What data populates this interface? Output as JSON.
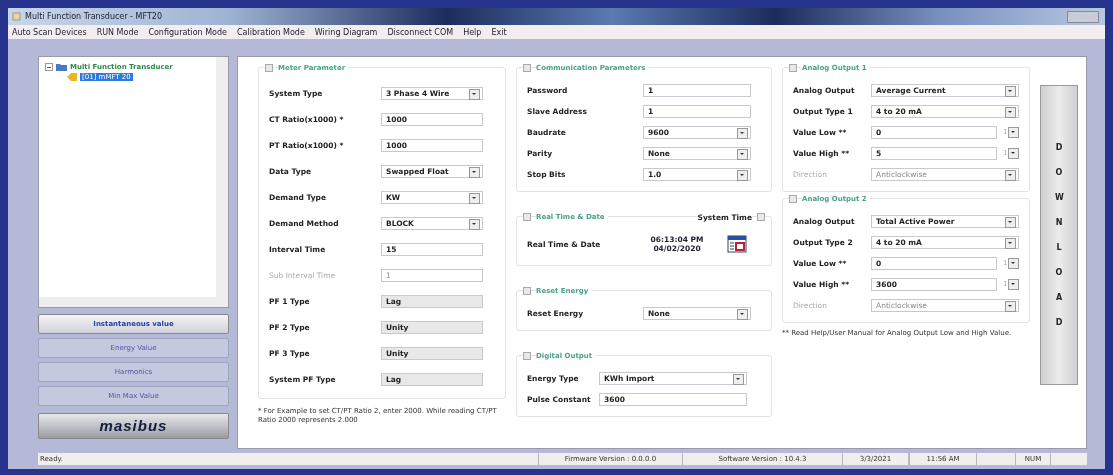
{
  "window": {
    "title": "Multi Function Transducer - MFT20"
  },
  "menu": [
    "Auto Scan Devices",
    "RUN Mode",
    "Configuration Mode",
    "Calibration Mode",
    "Wiring Diagram",
    "Disconnect COM",
    "Help",
    "Exit"
  ],
  "tree": {
    "label": "Multi Function Transducer",
    "expanded": true,
    "children": [
      {
        "label": "[01] mMFT 20",
        "selected": true
      }
    ]
  },
  "nav_buttons": [
    {
      "label": "Instantaneous value",
      "selected": true
    },
    {
      "label": "Energy Value",
      "selected": false
    },
    {
      "label": "Harmonics",
      "selected": false
    },
    {
      "label": "Min Max Value",
      "selected": false
    }
  ],
  "logo": "masibus",
  "columns": [
    {
      "groups": [
        {
          "title": "Meter Parameter",
          "checked": false,
          "rows": [
            {
              "label": "System Type",
              "kind": "dropdown",
              "value": "3 Phase 4 Wire",
              "disabled": false
            },
            {
              "label": "CT Ratio(x1000) *",
              "kind": "text",
              "value": "1000",
              "disabled": false
            },
            {
              "label": "PT Ratio(x1000) *",
              "kind": "text",
              "value": "1000",
              "disabled": false
            },
            {
              "label": "Data Type",
              "kind": "dropdown",
              "value": "Swapped Float",
              "disabled": false
            },
            {
              "label": "Demand Type",
              "kind": "dropdown",
              "value": "KW",
              "disabled": false
            },
            {
              "label": "Demand Method",
              "kind": "dropdown",
              "value": "BLOCK",
              "disabled": false
            },
            {
              "label": "Interval Time",
              "kind": "text",
              "value": "15",
              "disabled": false
            },
            {
              "label": "Sub Interval Time",
              "kind": "text",
              "value": "1",
              "disabled": true
            },
            {
              "label": "PF 1 Type",
              "kind": "readonly",
              "value": "Lag",
              "disabled": false
            },
            {
              "label": "PF 2 Type",
              "kind": "readonly",
              "value": "Unity",
              "disabled": false
            },
            {
              "label": "PF 3 Type",
              "kind": "readonly",
              "value": "Unity",
              "disabled": false
            },
            {
              "label": "System PF Type",
              "kind": "readonly",
              "value": "Lag",
              "disabled": false
            }
          ]
        }
      ],
      "note": "* For Example to set CT/PT Ratio 2, enter 2000. While reading CT/PT Ratio 2000 represents 2.000"
    },
    {
      "groups": [
        {
          "title": "Communication Parameters",
          "checked": false,
          "rows": [
            {
              "label": "Password",
              "kind": "text",
              "value": "1",
              "disabled": false
            },
            {
              "label": "Slave Address",
              "kind": "text",
              "value": "1",
              "disabled": false
            },
            {
              "label": "Baudrate",
              "kind": "dropdown",
              "value": "9600",
              "disabled": false
            },
            {
              "label": "Parity",
              "kind": "dropdown",
              "value": "None",
              "disabled": false
            },
            {
              "label": "Stop Bits",
              "kind": "dropdown",
              "value": "1.0",
              "disabled": false
            }
          ]
        },
        {
          "title": "Real Time & Date",
          "checked": false,
          "system_time": {
            "label": "System Time",
            "checked": false
          },
          "rows": [
            {
              "label": "Real Time & Date",
              "kind": "datetime",
              "time": "06:13:04 PM",
              "date": "04/02/2020",
              "disabled": false
            }
          ]
        },
        {
          "title": "Reset Energy",
          "checked": false,
          "rows": [
            {
              "label": "Reset Energy",
              "kind": "dropdown",
              "value": "None",
              "disabled": false
            }
          ]
        },
        {
          "title": "Digital Output",
          "checked": false,
          "rows": [
            {
              "label": "Energy Type",
              "kind": "dropdown",
              "value": "KWh Import",
              "disabled": false
            },
            {
              "label": "Pulse Constant",
              "kind": "text",
              "value": "3600",
              "disabled": false
            }
          ]
        }
      ]
    },
    {
      "groups": [
        {
          "title": "Analog Output 1",
          "checked": false,
          "rows": [
            {
              "label": "Analog Output",
              "kind": "dropdown",
              "value": "Average Current",
              "disabled": false
            },
            {
              "label": "Output Type 1",
              "kind": "dropdown",
              "value": "4 to 20 mA",
              "disabled": false
            },
            {
              "label": "Value Low **",
              "kind": "unit",
              "value": "0",
              "unit": "1",
              "disabled": false
            },
            {
              "label": "Value High **",
              "kind": "unit",
              "value": "5",
              "unit": "1",
              "disabled": false
            },
            {
              "label": "Direction",
              "kind": "dropdown",
              "value": "Anticlockwise",
              "disabled": true
            }
          ]
        },
        {
          "title": "Analog Output 2",
          "checked": false,
          "rows": [
            {
              "label": "Analog Output",
              "kind": "dropdown",
              "value": "Total Active Power",
              "disabled": false
            },
            {
              "label": "Output Type 2",
              "kind": "dropdown",
              "value": "4 to 20 mA",
              "disabled": false
            },
            {
              "label": "Value Low **",
              "kind": "unit",
              "value": "0",
              "unit": "1",
              "disabled": false
            },
            {
              "label": "Value High **",
              "kind": "unit",
              "value": "3600",
              "unit": "1",
              "disabled": false
            },
            {
              "label": "Direction",
              "kind": "dropdown",
              "value": "Anticlockwise",
              "disabled": true
            }
          ]
        }
      ],
      "note": "** Read Help/User Manual for Analog Output Low and High Value."
    }
  ],
  "download_button": "DOWNLOAD",
  "status_bar": [
    "Ready.",
    "Firmware Version : 0.0.0.0",
    "Software Version : 10.4.3",
    "3/3/2021",
    "11:56 AM",
    "NUM"
  ]
}
